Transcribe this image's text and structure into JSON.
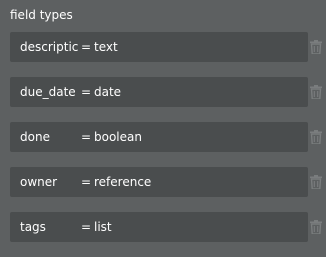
{
  "section": {
    "title": "field types"
  },
  "fields": [
    {
      "name": "descriptic",
      "sep": "=",
      "type": "text"
    },
    {
      "name": "due_date",
      "sep": "=",
      "type": "date"
    },
    {
      "name": "done",
      "sep": "=",
      "type": "boolean"
    },
    {
      "name": "owner",
      "sep": "=",
      "type": "reference"
    },
    {
      "name": "tags",
      "sep": "=",
      "type": "list"
    }
  ],
  "icons": {
    "delete": "trash-icon"
  },
  "colors": {
    "panel_bg": "#5d6061",
    "row_bg": "#4a4d4e",
    "icon": "#7a7d7e",
    "text": "#ffffff"
  }
}
